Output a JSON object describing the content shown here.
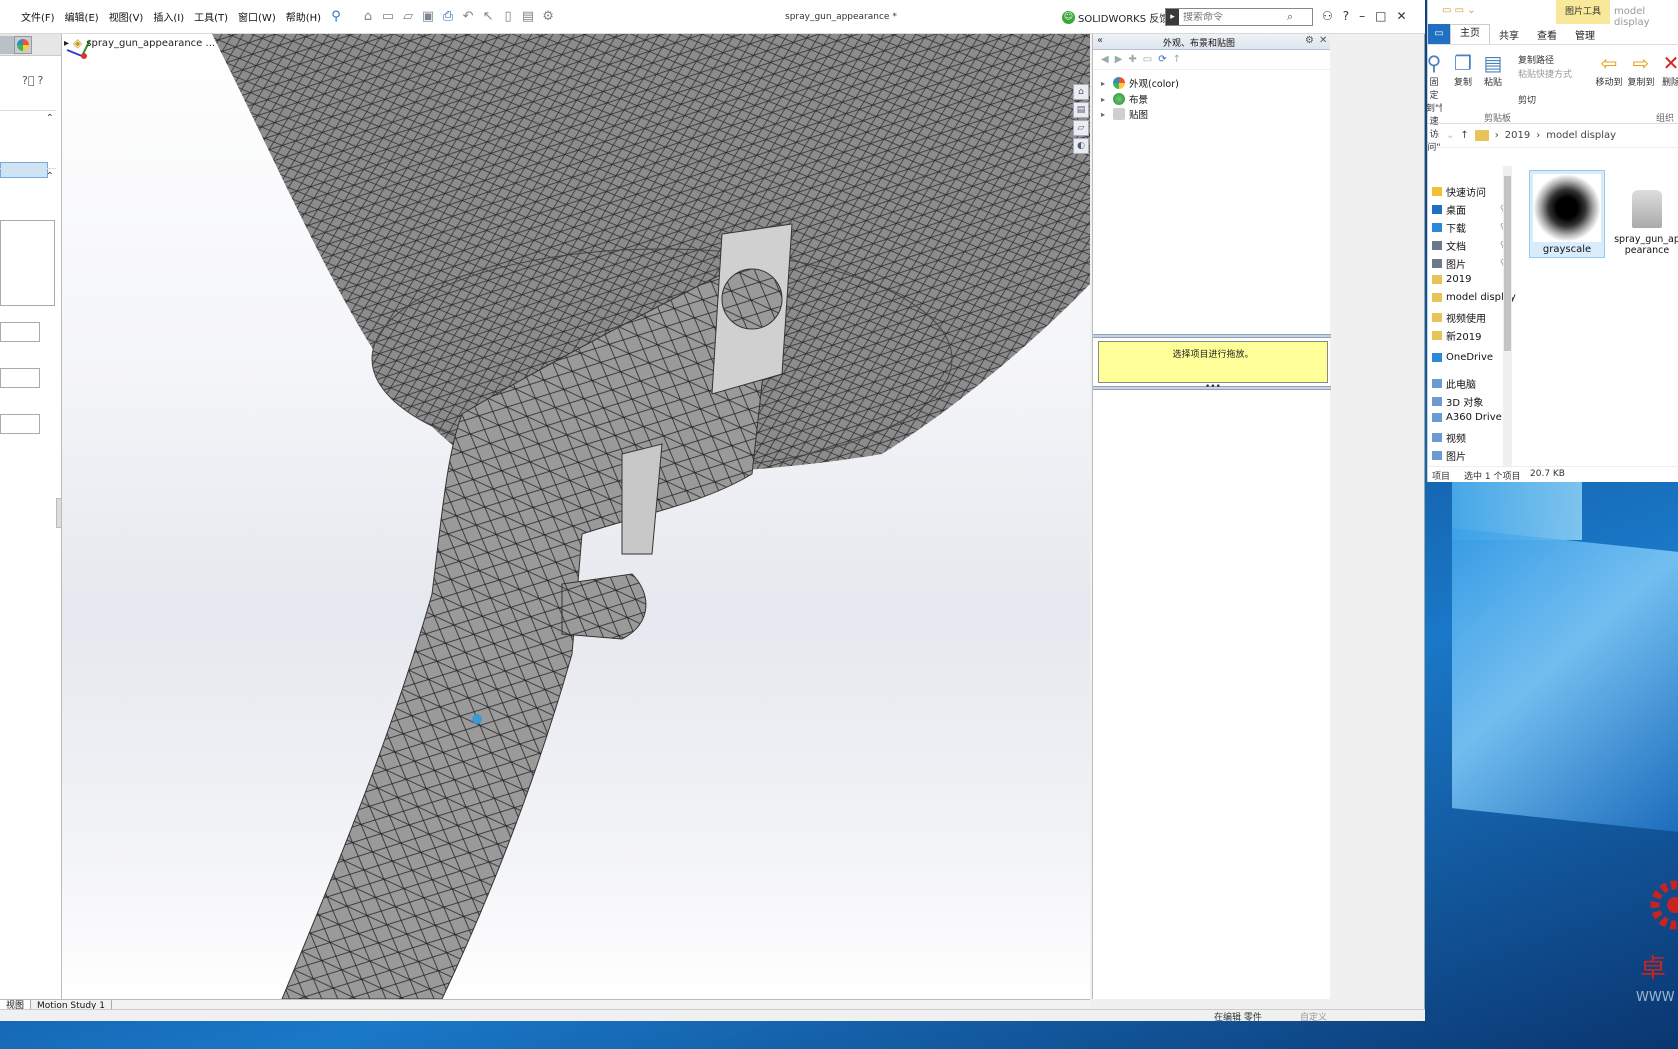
{
  "solidworks": {
    "menu": [
      "文件(F)",
      "编辑(E)",
      "视图(V)",
      "插入(I)",
      "工具(T)",
      "窗口(W)",
      "帮助(H)"
    ],
    "doc_title": "spray_gun_appearance *",
    "feedback_label": "SOLIDWORKS 反馈",
    "search_placeholder": "搜索命令",
    "tree_root": "spray_gun_appearance ...",
    "task_pane": {
      "title": "外观、布景和贴图",
      "items": [
        {
          "label": "外观(color)",
          "icon": "appearance-ball-icon"
        },
        {
          "label": "布景",
          "icon": "scene-icon"
        },
        {
          "label": "贴图",
          "icon": "decal-icon"
        }
      ],
      "hint": "选择项目进行拖放。"
    },
    "bottom_tabs": [
      "视图",
      "Motion Study 1"
    ],
    "status": {
      "editing": "在编辑 零件",
      "custom": "自定义"
    }
  },
  "explorer": {
    "title_tool_tag": "图片工具",
    "title_caption": "model display",
    "tabs": [
      "主页",
      "共享",
      "查看",
      "管理"
    ],
    "ribbon": {
      "pin_label": "固定到\"快速访问\"",
      "copy": "复制",
      "paste": "粘贴",
      "copy_path": "复制路径",
      "paste_shortcut": "粘贴快捷方式",
      "cut": "剪切",
      "move_to": "移动到",
      "copy_to": "复制到",
      "delete": "删除",
      "group_clipboard": "剪贴板",
      "group_organize": "组织"
    },
    "address": [
      "2019",
      "model display"
    ],
    "nav": [
      {
        "label": "快速访问",
        "pinned": false
      },
      {
        "label": "桌面",
        "pinned": true
      },
      {
        "label": "下载",
        "pinned": true
      },
      {
        "label": "文档",
        "pinned": true
      },
      {
        "label": "图片",
        "pinned": true
      },
      {
        "label": "2019",
        "pinned": false
      },
      {
        "label": "model display",
        "pinned": false
      },
      {
        "label": "视频使用",
        "pinned": false
      },
      {
        "label": "新2019",
        "pinned": false
      },
      {
        "label": "OneDrive",
        "pinned": false
      },
      {
        "label": "此电脑",
        "pinned": false
      },
      {
        "label": "3D 对象",
        "pinned": false
      },
      {
        "label": "A360 Drive",
        "pinned": false
      },
      {
        "label": "视频",
        "pinned": false
      },
      {
        "label": "图片",
        "pinned": false
      }
    ],
    "files": [
      {
        "name": "grayscale",
        "selected": true
      },
      {
        "name": "spray_gun_appearance",
        "selected": false
      }
    ],
    "status": {
      "items": "项目",
      "selected": "选中 1 个项目",
      "size": "20.7 KB"
    }
  },
  "desktop": {
    "logo_text": "卓",
    "watermark": "WWW"
  },
  "colors": {
    "accent": "#1f6fc2",
    "hint_bg": "#ffff99",
    "mesh_fill": "#8c8c8c",
    "mesh_line": "#2a2a2a"
  }
}
